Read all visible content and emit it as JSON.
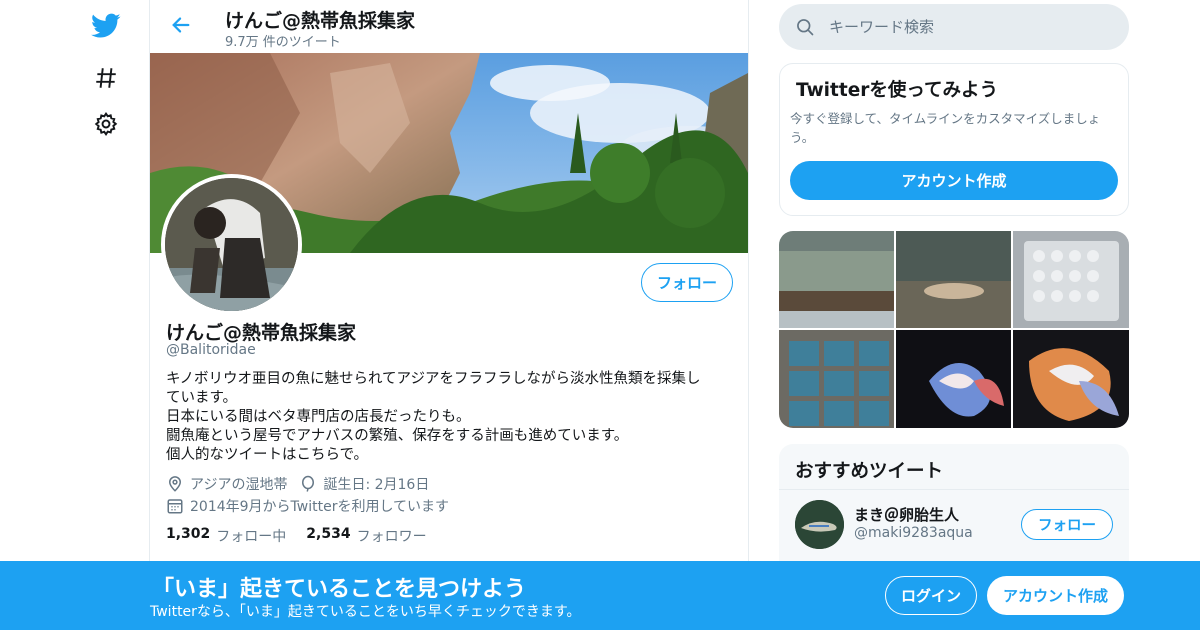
{
  "colors": {
    "accent": "#1da1f2",
    "secondary_text": "#657786",
    "border": "#e6ecf0"
  },
  "nav": {
    "icons": [
      "twitter-bird-icon",
      "hashtag-icon",
      "gear-icon"
    ]
  },
  "header": {
    "name": "けんご@熱帯魚採集家",
    "tweet_count": "9.7万 件のツイート"
  },
  "profile": {
    "follow_label": "フォロー",
    "name": "けんご@熱帯魚採集家",
    "handle": "@Balitoridae",
    "bio_lines": [
      "キノボリウオ亜目の魚に魅せられてアジアをフラフラしながら淡水性魚類を採集し",
      "ています。",
      "日本にいる間はベタ専門店の店長だったりも。",
      "闘魚庵という屋号でアナバスの繁殖、保存をする計画も進めています。",
      "個人的なツイートはこちらで。"
    ],
    "location": "アジアの湿地帯",
    "birthday": "誕生日: 2月16日",
    "joined": "2014年9月からTwitterを利用しています",
    "following_count": "1,302",
    "following_label": "フォロー中",
    "followers_count": "2,534",
    "followers_label": "フォロワー"
  },
  "search": {
    "placeholder": "キーワード検索"
  },
  "signup_card": {
    "title": "Twitterを使ってみよう",
    "description": "今すぐ登録して、タイムラインをカスタマイズしましょう。",
    "button": "アカウント作成"
  },
  "recommended": {
    "title": "おすすめツイート",
    "user_name": "まき＠卵胎生人",
    "user_handle": "@maki9283aqua",
    "follow_label": "フォロー"
  },
  "bottom_bar": {
    "title": "「いま」起きていることを見つけよう",
    "subtitle": "Twitterなら、「いま」起きていることをいち早くチェックできます。",
    "login": "ログイン",
    "signup": "アカウント作成"
  }
}
